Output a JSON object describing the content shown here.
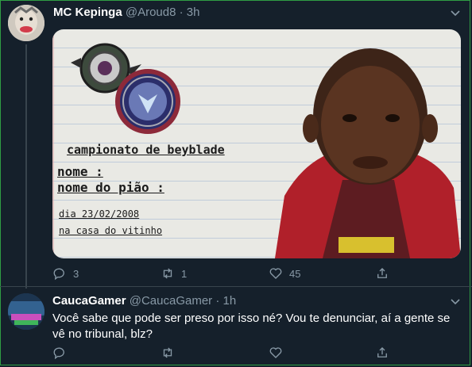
{
  "tweet1": {
    "author_name": "MC Kepinga",
    "handle": "@Aroud8",
    "dot": "·",
    "time": "3h",
    "media": {
      "line_title": "campionato de beyblade",
      "line_name": "nome :",
      "line_top_name": "nome do pião :",
      "line_date": "dia 23/02/2008",
      "line_place": "na casa do vitinho"
    },
    "actions": {
      "reply_count": "3",
      "retweet_count": "1",
      "like_count": "45"
    }
  },
  "tweet2": {
    "author_name": "CaucaGamer",
    "handle": "@CaucaGamer",
    "dot": "·",
    "time": "1h",
    "text": "Você sabe que pode ser preso por isso né? Vou te denunciar, aí a gente se vê no tribunal, blz?"
  },
  "colors": {
    "background": "#15202b",
    "secondary_text": "#8899a6",
    "divider": "#38444d",
    "frame": "#2f9e44"
  },
  "icons": [
    "chevron-down-icon",
    "reply-icon",
    "retweet-icon",
    "like-icon",
    "share-icon"
  ]
}
